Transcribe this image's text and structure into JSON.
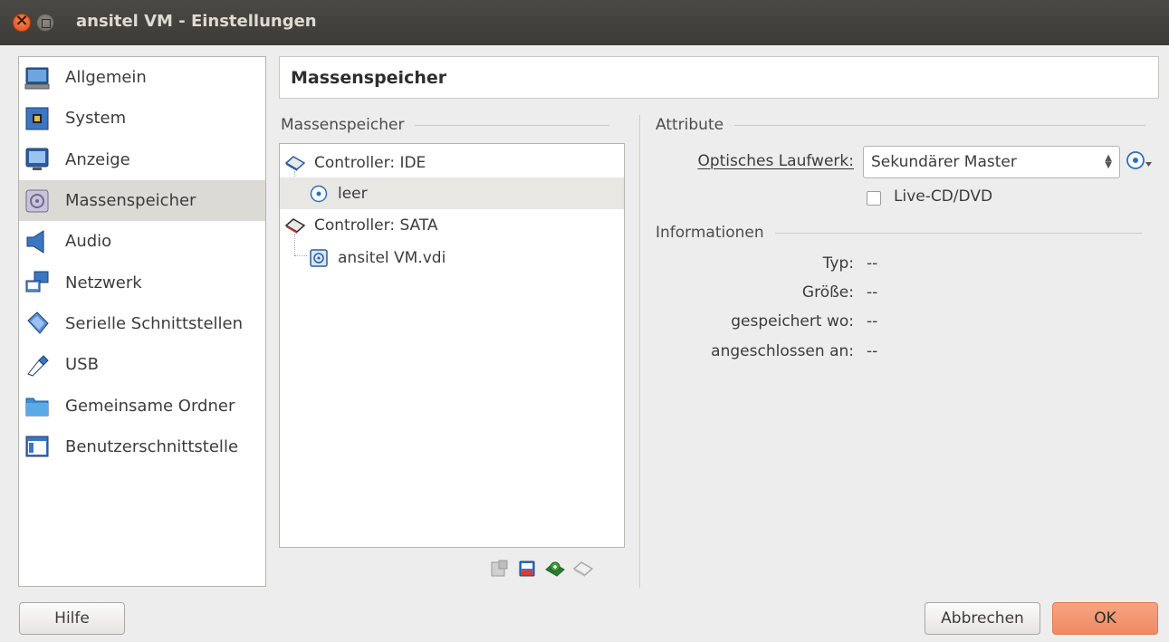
{
  "window": {
    "title": "ansitel VM - Einstellungen"
  },
  "sidebar": {
    "items": [
      {
        "label": "Allgemein",
        "icon": "monitor-icon"
      },
      {
        "label": "System",
        "icon": "chip-icon"
      },
      {
        "label": "Anzeige",
        "icon": "display-icon"
      },
      {
        "label": "Massenspeicher",
        "icon": "storage-icon",
        "active": true
      },
      {
        "label": "Audio",
        "icon": "speaker-icon"
      },
      {
        "label": "Netzwerk",
        "icon": "network-icon"
      },
      {
        "label": "Serielle Schnittstellen",
        "icon": "serial-port-icon"
      },
      {
        "label": "USB",
        "icon": "usb-icon"
      },
      {
        "label": "Gemeinsame Ordner",
        "icon": "folder-icon"
      },
      {
        "label": "Benutzerschnittstelle",
        "icon": "ui-window-icon"
      }
    ]
  },
  "header": {
    "title": "Massenspeicher"
  },
  "storage": {
    "group_title": "Massenspeicher",
    "tree": [
      {
        "label": "Controller: IDE",
        "kind": "controller"
      },
      {
        "label": "leer",
        "kind": "optical",
        "selected": true
      },
      {
        "label": "Controller: SATA",
        "kind": "controller"
      },
      {
        "label": "ansitel VM.vdi",
        "kind": "disk"
      }
    ]
  },
  "attributes": {
    "group_title": "Attribute",
    "optical_drive_label": "Optisches Laufwerk:",
    "optical_drive_value": "Sekundärer Master",
    "live_cd_label": "Live-CD/DVD",
    "live_cd_checked": false
  },
  "info": {
    "group_title": "Informationen",
    "rows": [
      {
        "label": "Typ:",
        "value": "--"
      },
      {
        "label": "Größe:",
        "value": "--"
      },
      {
        "label": "gespeichert wo:",
        "value": "--"
      },
      {
        "label": "angeschlossen an:",
        "value": "--"
      }
    ]
  },
  "buttons": {
    "help": "Hilfe",
    "cancel": "Abbrechen",
    "ok": "OK"
  },
  "colors": {
    "accent": "#ef8a62",
    "titlebar": "#3c3b37",
    "close": "#df4a16"
  }
}
